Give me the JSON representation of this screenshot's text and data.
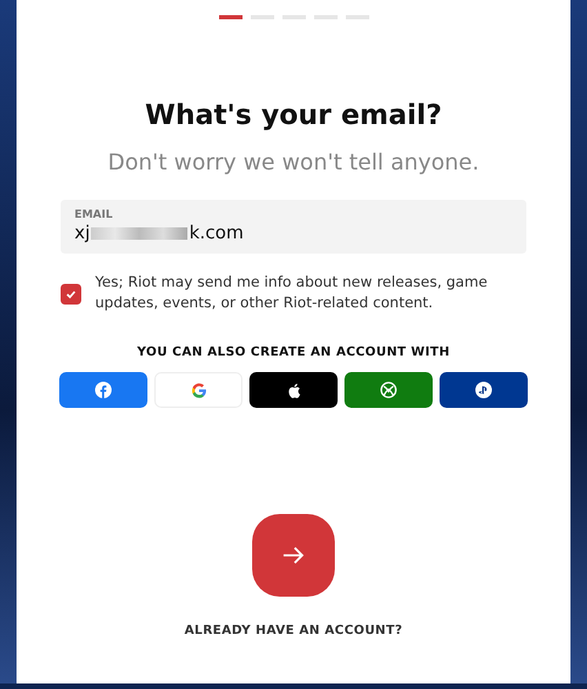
{
  "steps": [
    {
      "selected": true
    },
    {
      "selected": false
    },
    {
      "selected": false
    },
    {
      "selected": false
    },
    {
      "selected": false
    }
  ],
  "title": "What's your email?",
  "subtitle": "Don't worry we won't tell anyone.",
  "email_field": {
    "label": "EMAIL",
    "value_start": "xj",
    "value_end": "k.com",
    "redacted": true
  },
  "consent": {
    "checked": true,
    "text": "Yes; Riot may send me info about new releases, game updates, events, or other Riot-related content."
  },
  "alt_heading": "YOU CAN ALSO CREATE AN ACCOUNT WITH",
  "providers": [
    {
      "kind": "facebook"
    },
    {
      "kind": "google"
    },
    {
      "kind": "apple"
    },
    {
      "kind": "xbox"
    },
    {
      "kind": "playstation"
    }
  ],
  "footer_link": "ALREADY HAVE AN ACCOUNT?"
}
